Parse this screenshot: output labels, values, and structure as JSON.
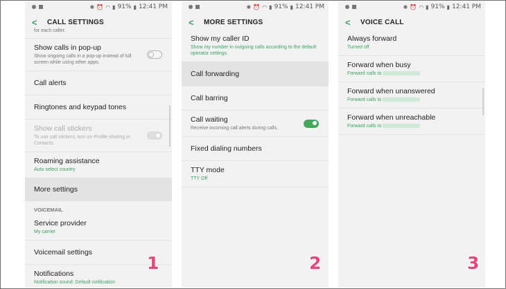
{
  "status": {
    "battery": "91%",
    "time": "12:41 PM"
  },
  "screens": [
    {
      "title": "CALL SETTINGS",
      "top_partial": "for each caller.",
      "items": [
        {
          "title": "Show calls in pop-up",
          "sub": "Show ongoing calls in a pop-up instead of full screen while using other apps."
        },
        {
          "title": "Call alerts"
        },
        {
          "title": "Ringtones and keypad tones"
        },
        {
          "title": "Show call stickers",
          "sub": "To use call stickers, turn on Profile sharing in Contacts."
        },
        {
          "title": "Roaming assistance",
          "sub": "Auto select country"
        },
        {
          "title": "More settings"
        }
      ],
      "section": "VOICEMAIL",
      "items2": [
        {
          "title": "Service provider",
          "sub": "My carrier"
        },
        {
          "title": "Voicemail settings"
        },
        {
          "title": "Notifications",
          "sub": "Notification sound: Default notification"
        }
      ],
      "step": "1"
    },
    {
      "title": "MORE SETTINGS",
      "items": [
        {
          "title": "Show my caller ID",
          "sub": "Show my number in outgoing calls according to the default operator settings."
        },
        {
          "title": "Call forwarding"
        },
        {
          "title": "Call barring"
        },
        {
          "title": "Call waiting",
          "sub": "Receive incoming call alerts during calls."
        },
        {
          "title": "Fixed dialing numbers"
        },
        {
          "title": "TTY mode",
          "sub": "TTY Off"
        }
      ],
      "step": "2"
    },
    {
      "title": "VOICE CALL",
      "items": [
        {
          "title": "Always forward",
          "sub": "Turned off"
        },
        {
          "title": "Forward when busy",
          "sub": "Forward calls to"
        },
        {
          "title": "Forward when unanswered",
          "sub": "Forward calls to"
        },
        {
          "title": "Forward when unreachable",
          "sub": "Forward calls to"
        }
      ],
      "step": "3"
    }
  ],
  "toggles": {
    "show_calls_popup": false,
    "show_call_stickers": true,
    "call_waiting": true
  },
  "colors": {
    "accent": "#3aa35f",
    "step_number": "#e8457c",
    "highlight": "#e3e3e3"
  }
}
